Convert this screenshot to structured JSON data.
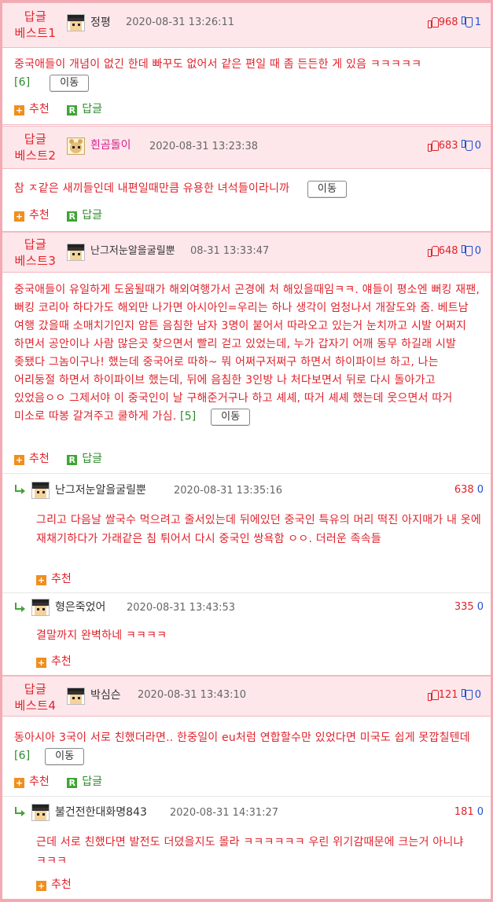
{
  "colors": {
    "accent_red": "#e0232c",
    "header_bg": "#fde7ea",
    "border_pink": "#f4aab3",
    "green": "#3fa535",
    "blue": "#1f4fd6"
  },
  "labels": {
    "move_button": "이동",
    "recommend": "추천",
    "reply": "답글"
  },
  "best": [
    {
      "label_line1": "답글",
      "label_line2": "베스트1",
      "nick": "정평",
      "date": "2020-08-31 13:26:11",
      "up": "968",
      "down": "1",
      "text": "중국애들이 개념이 없긴 한데 빠꾸도 없어서 같은 편일 때 좀 든든한 게 있음 ㅋㅋㅋㅋㅋ",
      "reply_count": "[6]"
    },
    {
      "label_line1": "답글",
      "label_line2": "베스트2",
      "nick": "흰곰돌이",
      "date": "2020-08-31 13:23:38",
      "up": "683",
      "down": "0",
      "text": "참 ㅈ같은 새끼들인데 내편일때만큼 유용한 녀석들이라니까",
      "reply_count": ""
    },
    {
      "label_line1": "답글",
      "label_line2": "베스트3",
      "nick": "난그저눈알을굴릴뿐",
      "date": "08-31 13:33:47",
      "up": "648",
      "down": "0",
      "text": "중국애들이 유일하게 도움될때가 해외여행가서 곤경에 처 해있을때임ㅋㅋ. 얘들이 평소엔 뻐킹 재팬, 뻐킹 코리아 하다가도 해외만 나가면 아시아인=우리는 하나 생각이 엄청나서 개잘도와 줌. 베트남 여행 갔을때 소매치기인지 암튼 음침한 남자 3명이 붙어서 따라오고 있는거 눈치까고 시발 어쩌지 하면서 공안이나 사람 많은곳 찾으면서 빨리 걷고 있었는데, 누가 갑자기 어깨 동무 하길래 시발 좆됐다 그놈이구나! 했는데 중국어로 따하~ 뭐 어쩌구저쩌구 하면서 하이파이브 하고, 나는 어리둥절 하면서 하이파이브 했는데, 뒤에 음침한 3인방 나 처다보면서 뒤로 다시 돌아가고 있었음ㅇㅇ 그제서야 이 중국인이 날 구해준거구나 하고 셰셰, 따거 셰셰 했는데 웃으면서 따거 미소로 따봉 갈겨주고 쿨하게 가심.",
      "reply_count": "[5]"
    },
    {
      "label_line1": "답글",
      "label_line2": "베스트4",
      "nick": "박심슨",
      "date": "2020-08-31 13:43:10",
      "up": "121",
      "down": "0",
      "text": "동아시아 3국이 서로 친했더라면.. 한중일이 eu처럼 연합할수만 있었다면 미국도 쉽게 못깝칠텐데",
      "reply_count": "[6]"
    }
  ],
  "replies": [
    {
      "nick": "난그저눈알을굴릴뿐",
      "date": "2020-08-31 13:35:16",
      "up": "638",
      "down": "0",
      "text": "그리고 다음날 쌀국수 먹으려고 줄서있는데 뒤에있던 중국인 특유의 머리 떡진 아지매가 내 옷에 재채기하다가 가래같은 침 튀어서 다시 중국인 쌍욕함 ㅇㅇ. 더러운 족속들"
    },
    {
      "nick": "형은죽었어",
      "date": "2020-08-31 13:43:53",
      "up": "335",
      "down": "0",
      "text": "결말까지 완벽하네 ㅋㅋㅋㅋ"
    },
    {
      "nick": "불건전한대화명843",
      "date": "2020-08-31 14:31:27",
      "up": "181",
      "down": "0",
      "text": "근데 서로 친했다면 발전도 더뎠을지도 몰라 ㅋㅋㅋㅋㅋㅋ 우린 위기감때문에 크는거 아니냐 ㅋㅋㅋ"
    }
  ]
}
